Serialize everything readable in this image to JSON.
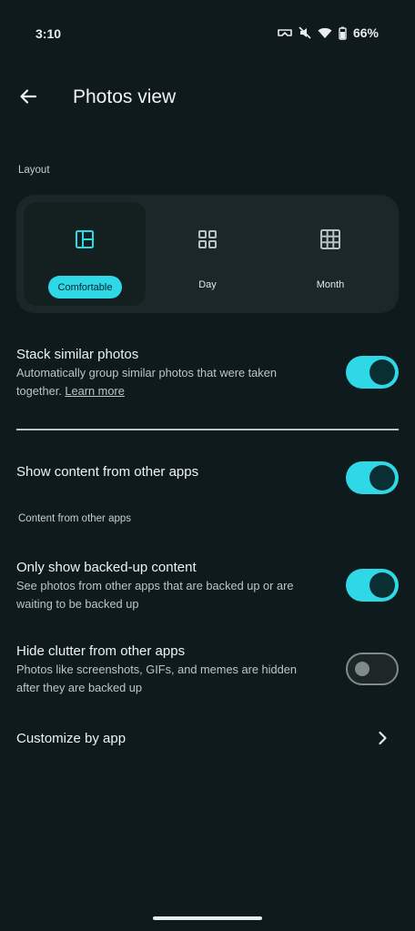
{
  "status_bar": {
    "time": "3:10",
    "battery": "66%",
    "icons": [
      "vr-headset-icon",
      "mute-icon",
      "wifi-icon",
      "battery-icon"
    ]
  },
  "header": {
    "title": "Photos view",
    "back_icon": "arrow-back-icon"
  },
  "layout": {
    "section_label": "Layout",
    "options": [
      {
        "label": "Comfortable",
        "icon": "comfortable-layout-icon",
        "selected": true
      },
      {
        "label": "Day",
        "icon": "day-grid-icon",
        "selected": false
      },
      {
        "label": "Month",
        "icon": "month-grid-icon",
        "selected": false
      }
    ]
  },
  "settings": {
    "stack_similar": {
      "title": "Stack similar photos",
      "description": "Automatically group similar photos that were taken together.",
      "link": "Learn more",
      "enabled": true
    },
    "show_other_apps": {
      "title": "Show content from other apps",
      "enabled": true
    },
    "other_apps_section_label": "Content from other apps",
    "only_backed_up": {
      "title": "Only show backed-up content",
      "description": "See photos from other apps that are backed up or are waiting to be backed up",
      "enabled": true
    },
    "hide_clutter": {
      "title": "Hide clutter from other apps",
      "description": "Photos like screenshots, GIFs, and memes are hidden after they are backed up",
      "enabled": false
    },
    "customize_by_app": {
      "title": "Customize by app",
      "icon": "chevron-right-icon"
    }
  },
  "colors": {
    "background": "#0f1a1c",
    "accent": "#2fd8e6",
    "card": "#1b2729"
  }
}
